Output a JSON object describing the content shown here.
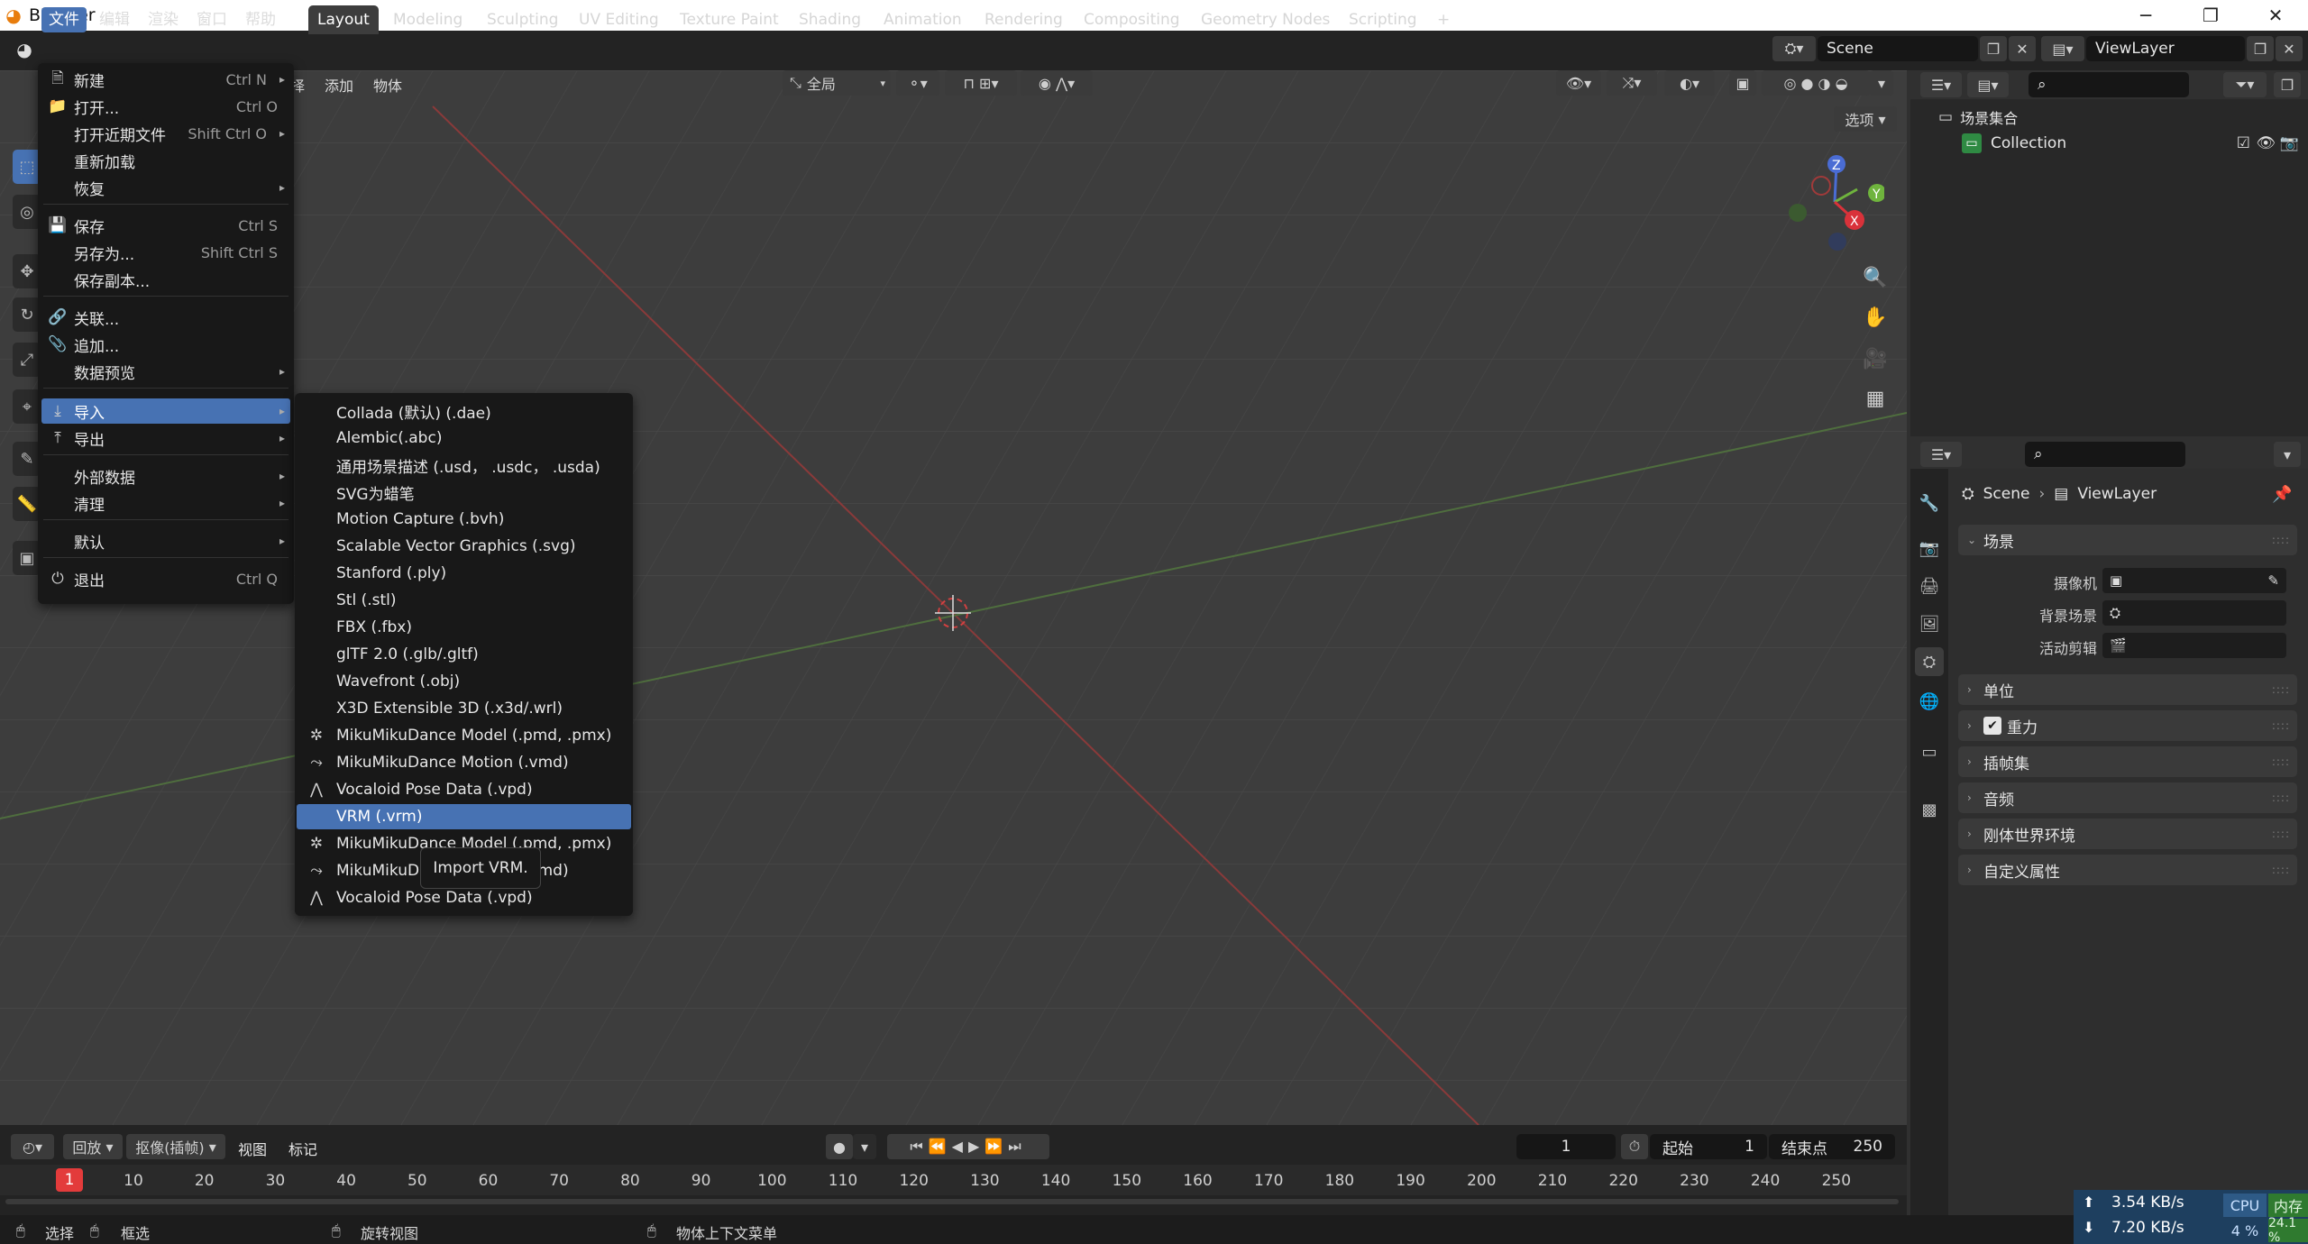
{
  "window": {
    "title": "Blender"
  },
  "topmenu": [
    "文件",
    "编辑",
    "渲染",
    "窗口",
    "帮助"
  ],
  "workspaces": [
    "Layout",
    "Modeling",
    "Sculpting",
    "UV Editing",
    "Texture Paint",
    "Shading",
    "Animation",
    "Rendering",
    "Compositing",
    "Geometry Nodes",
    "Scripting"
  ],
  "add_workspace": "+",
  "scene_field": "Scene",
  "viewlayer_field": "ViewLayer",
  "viewport": {
    "header_menus": [
      "择",
      "添加",
      "物体"
    ],
    "transform_orient": "全局",
    "options_button": "选项",
    "axes": {
      "x": "X",
      "y": "Y",
      "z": "Z"
    }
  },
  "file_menu": {
    "items": [
      {
        "icon": "new-icon",
        "label": "新建",
        "shortcut": "Ctrl N",
        "submenu": true
      },
      {
        "icon": "folder-icon",
        "label": "打开...",
        "shortcut": "Ctrl O",
        "submenu": false
      },
      {
        "icon": "",
        "label": "打开近期文件",
        "shortcut": "Shift Ctrl O",
        "submenu": true
      },
      {
        "icon": "",
        "label": "重新加载",
        "shortcut": "",
        "submenu": false
      },
      {
        "icon": "",
        "label": "恢复",
        "shortcut": "",
        "submenu": true
      },
      {
        "icon": "save-icon",
        "label": "保存",
        "shortcut": "Ctrl S",
        "submenu": false
      },
      {
        "icon": "",
        "label": "另存为...",
        "shortcut": "Shift Ctrl S",
        "submenu": false
      },
      {
        "icon": "",
        "label": "保存副本...",
        "shortcut": "",
        "submenu": false
      },
      {
        "icon": "link-icon",
        "label": "关联...",
        "shortcut": "",
        "submenu": false
      },
      {
        "icon": "append-icon",
        "label": "追加...",
        "shortcut": "",
        "submenu": false
      },
      {
        "icon": "",
        "label": "数据预览",
        "shortcut": "",
        "submenu": true
      },
      {
        "icon": "import-icon",
        "label": "导入",
        "shortcut": "",
        "submenu": true
      },
      {
        "icon": "export-icon",
        "label": "导出",
        "shortcut": "",
        "submenu": true
      },
      {
        "icon": "",
        "label": "外部数据",
        "shortcut": "",
        "submenu": true
      },
      {
        "icon": "",
        "label": "清理",
        "shortcut": "",
        "submenu": true
      },
      {
        "icon": "",
        "label": "默认",
        "shortcut": "",
        "submenu": true
      },
      {
        "icon": "power-icon",
        "label": "退出",
        "shortcut": "Ctrl Q",
        "submenu": false
      }
    ]
  },
  "import_menu": {
    "items": [
      {
        "icon": "",
        "label": "Collada (默认) (.dae)"
      },
      {
        "icon": "",
        "label": "Alembic(.abc)"
      },
      {
        "icon": "",
        "label": "通用场景描述 (.usd， .usdc， .usda)"
      },
      {
        "icon": "",
        "label": "SVG为蜡笔"
      },
      {
        "icon": "",
        "label": "Motion Capture (.bvh)"
      },
      {
        "icon": "",
        "label": "Scalable Vector Graphics (.svg)"
      },
      {
        "icon": "",
        "label": "Stanford (.ply)"
      },
      {
        "icon": "",
        "label": "Stl (.stl)"
      },
      {
        "icon": "",
        "label": "FBX (.fbx)"
      },
      {
        "icon": "",
        "label": "glTF 2.0 (.glb/.gltf)"
      },
      {
        "icon": "",
        "label": "Wavefront (.obj)"
      },
      {
        "icon": "",
        "label": "X3D Extensible 3D (.x3d/.wrl)"
      },
      {
        "icon": "armature-icon",
        "label": "MikuMikuDance Model (.pmd, .pmx)"
      },
      {
        "icon": "motion-icon",
        "label": "MikuMikuDance Motion (.vmd)"
      },
      {
        "icon": "pose-icon",
        "label": "Vocaloid Pose Data (.vpd)"
      },
      {
        "icon": "",
        "label": "VRM (.vrm)"
      },
      {
        "icon": "armature-icon",
        "label": "MikuMikuDance Model (.pmd, .pmx)"
      },
      {
        "icon": "motion-icon",
        "label": "MikuMikuDance Motion (.vmd)"
      },
      {
        "icon": "pose-icon",
        "label": "Vocaloid Pose Data (.vpd)"
      }
    ],
    "highlighted": "VRM (.vrm)"
  },
  "tooltip": "Import VRM.",
  "outliner": {
    "root": "场景集合",
    "collection": "Collection"
  },
  "properties": {
    "breadcrumb_scene": "Scene",
    "breadcrumb_viewlayer": "ViewLayer",
    "scene_panel": "场景",
    "camera_label": "摄像机",
    "background_label": "背景场景",
    "active_clip_label": "活动剪辑",
    "panels": [
      "单位",
      "重力",
      "插帧集",
      "音频",
      "刚体世界环境",
      "自定义属性"
    ],
    "gravity_checked": true
  },
  "timeline": {
    "playback": "回放",
    "keying": "抠像(插帧)",
    "view": "视图",
    "marker": "标记",
    "current_frame": "1",
    "start_label": "起始",
    "start_value": "1",
    "end_label": "结束点",
    "end_value": "250",
    "playhead": "1",
    "ticks": [
      "10",
      "20",
      "30",
      "40",
      "50",
      "60",
      "70",
      "80",
      "90",
      "100",
      "110",
      "120",
      "130",
      "140",
      "150",
      "160",
      "170",
      "180",
      "190",
      "200",
      "210",
      "220",
      "230",
      "240",
      "250"
    ]
  },
  "statusbar": {
    "select": "选择",
    "box_select": "框选",
    "rotate_view": "旋转视图",
    "context_menu": "物体上下文菜单"
  },
  "netmon": {
    "upload": "3.54 KB/s",
    "download": "7.20 KB/s",
    "cpu_label": "CPU",
    "cpu_value": "4 %",
    "mem_label": "内存",
    "mem_value": "24.1 %"
  }
}
